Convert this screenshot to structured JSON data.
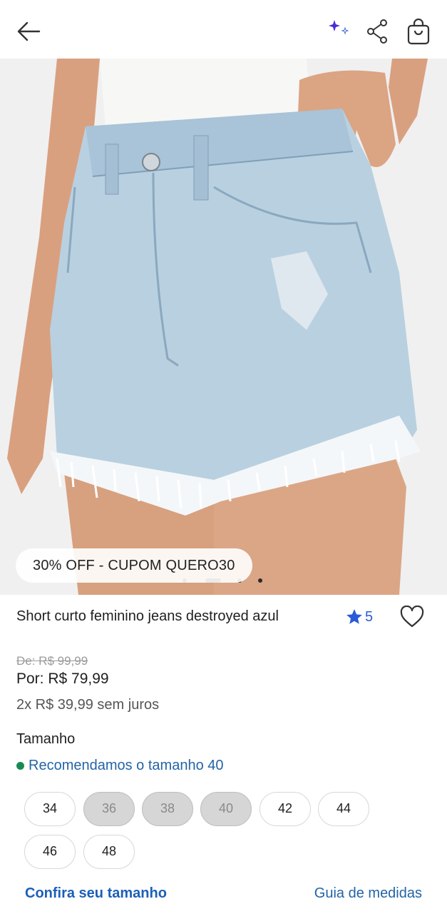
{
  "header": {
    "back_icon": "arrow-left-icon",
    "sparkle_icon": "sparkle-icon",
    "share_icon": "share-icon",
    "bag_icon": "shopping-bag-icon"
  },
  "gallery": {
    "image": "denim-shorts-photo",
    "coupon_label": "30% OFF - CUPOM QUERO30",
    "active_slide": 2,
    "slide_count": 5
  },
  "product": {
    "title": "Short curto feminino jeans destroyed azul",
    "rating": "5",
    "old_price": "De: R$ 99,99",
    "price": "Por: R$ 79,99",
    "installments": "2x R$ 39,99 sem juros"
  },
  "sizes": {
    "heading": "Tamanho",
    "recommendation": "Recomendamos o tamanho 40",
    "options": [
      {
        "label": "34",
        "available": true
      },
      {
        "label": "36",
        "available": false
      },
      {
        "label": "38",
        "available": false
      },
      {
        "label": "40",
        "available": false
      },
      {
        "label": "42",
        "available": true
      },
      {
        "label": "44",
        "available": true
      },
      {
        "label": "46",
        "available": true
      },
      {
        "label": "48",
        "available": true
      }
    ]
  },
  "links": {
    "check_size": "Confira seu tamanho",
    "size_guide": "Guia de medidas"
  },
  "colors": {
    "accent_blue": "#2464a6",
    "star_blue": "#2a5bd7",
    "recommend_green": "#1a8a55",
    "disabled_chip": "#d6d6d6"
  }
}
